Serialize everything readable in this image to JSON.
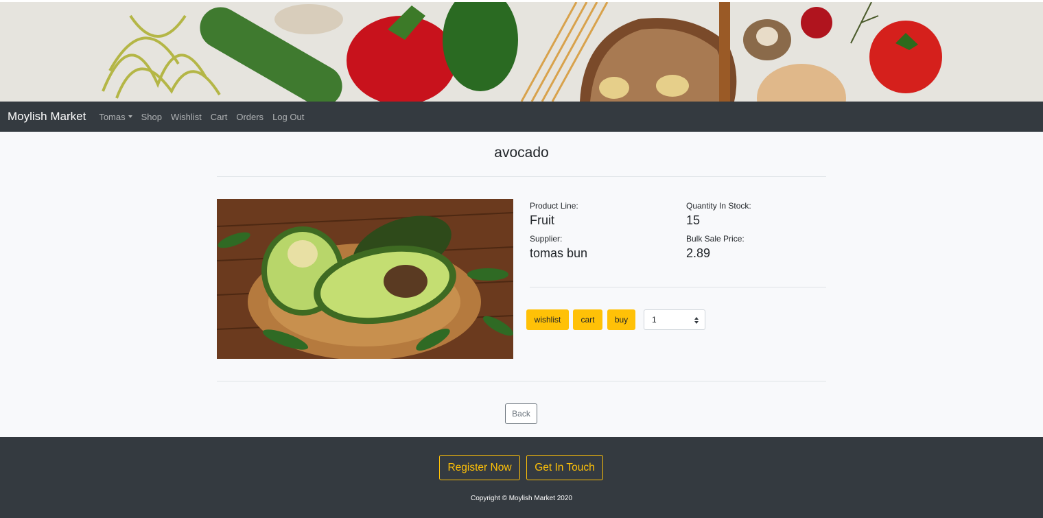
{
  "navbar": {
    "brand": "Moylish Market",
    "items": [
      {
        "label": "Tomas",
        "dropdown": true
      },
      {
        "label": "Shop"
      },
      {
        "label": "Wishlist"
      },
      {
        "label": "Cart"
      },
      {
        "label": "Orders"
      },
      {
        "label": "Log Out"
      }
    ]
  },
  "product": {
    "title": "avocado",
    "product_line_label": "Product Line:",
    "product_line": "Fruit",
    "quantity_label": "Quantity In Stock:",
    "quantity": "15",
    "supplier_label": "Supplier:",
    "supplier": "tomas bun",
    "price_label": "Bulk Sale Price:",
    "price": "2.89"
  },
  "actions": {
    "wishlist": "wishlist",
    "cart": "cart",
    "buy": "buy",
    "quantity_selected": "1",
    "back": "Back"
  },
  "footer": {
    "register": "Register Now",
    "contact": "Get In Touch",
    "copyright": "Copyright © Moylish Market 2020"
  },
  "colors": {
    "navbar_bg": "#343a40",
    "accent": "#ffc107",
    "page_bg": "#f8f9fb"
  }
}
